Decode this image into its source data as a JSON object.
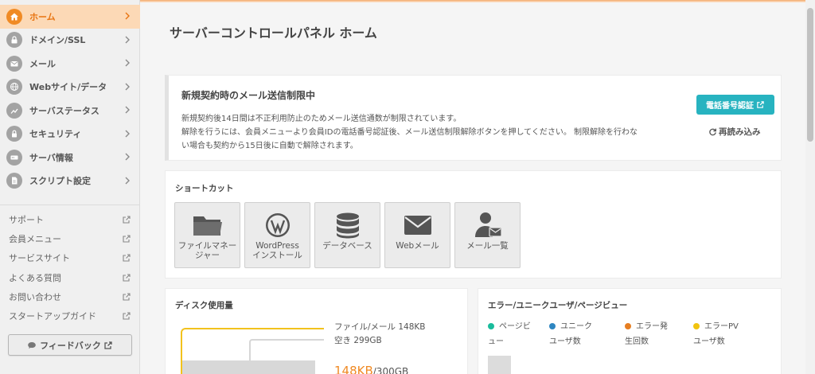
{
  "sidebar": {
    "nav": [
      {
        "label": "ホーム",
        "icon": "home-icon",
        "active": true
      },
      {
        "label": "ドメイン/SSL",
        "icon": "lock-icon",
        "active": false
      },
      {
        "label": "メール",
        "icon": "mail-icon",
        "active": false
      },
      {
        "label": "Webサイト/データ",
        "icon": "globe-icon",
        "active": false
      },
      {
        "label": "サーバステータス",
        "icon": "chart-icon",
        "active": false
      },
      {
        "label": "セキュリティ",
        "icon": "padlock-icon",
        "active": false
      },
      {
        "label": "サーバ情報",
        "icon": "server-icon",
        "active": false
      },
      {
        "label": "スクリプト設定",
        "icon": "script-icon",
        "active": false
      }
    ],
    "links": [
      "サポート",
      "会員メニュー",
      "サービスサイト",
      "よくある質問",
      "お問い合わせ",
      "スタートアップガイド"
    ],
    "feedback_label": "フィードバック"
  },
  "main": {
    "title": "サーバーコントロールパネル ホーム",
    "notice": {
      "title": "新規契約時のメール送信制限中",
      "lines": [
        "新規契約後14日間は不正利用防止のためメール送信通数が制限されています。",
        "解除を行うには、会員メニューより会員IDの電話番号認証後、メール送信制限解除ボタンを押してください。 制限解除を行わな",
        "い場合も契約から15日後に自動で解除されます。"
      ],
      "phone_button": "電話番号認証",
      "reload_button": "再読み込み"
    },
    "shortcuts": {
      "title": "ショートカット",
      "items": [
        {
          "label": "ファイルマネー\nジャー",
          "icon": "folder-icon"
        },
        {
          "label": "WordPress\nインストール",
          "icon": "wordpress-icon"
        },
        {
          "label": "データベース",
          "icon": "database-icon"
        },
        {
          "label": "Webメール",
          "icon": "envelope-icon"
        },
        {
          "label": "メール一覧",
          "icon": "user-mail-icon"
        }
      ]
    },
    "disk": {
      "title": "ディスク使用量",
      "file_mail": "ファイル/メール 148KB",
      "free": "空き 299GB",
      "used": "148KB",
      "total": "/300GB"
    },
    "errors": {
      "title": "エラー/ユニークユーザ/ページビュー",
      "legend": [
        {
          "label": "ページビュー",
          "color": "#1abc9c"
        },
        {
          "label": "ユニークユーザ数",
          "color": "#2e86c1"
        },
        {
          "label": "エラー発生回数",
          "color": "#e67e22"
        },
        {
          "label": "エラーPVユーザ数",
          "color": "#f1c40f"
        }
      ]
    }
  },
  "colors": {
    "accent": "#f08a24",
    "teal": "#27b3c0",
    "active_bg": "#fcd9b6"
  }
}
